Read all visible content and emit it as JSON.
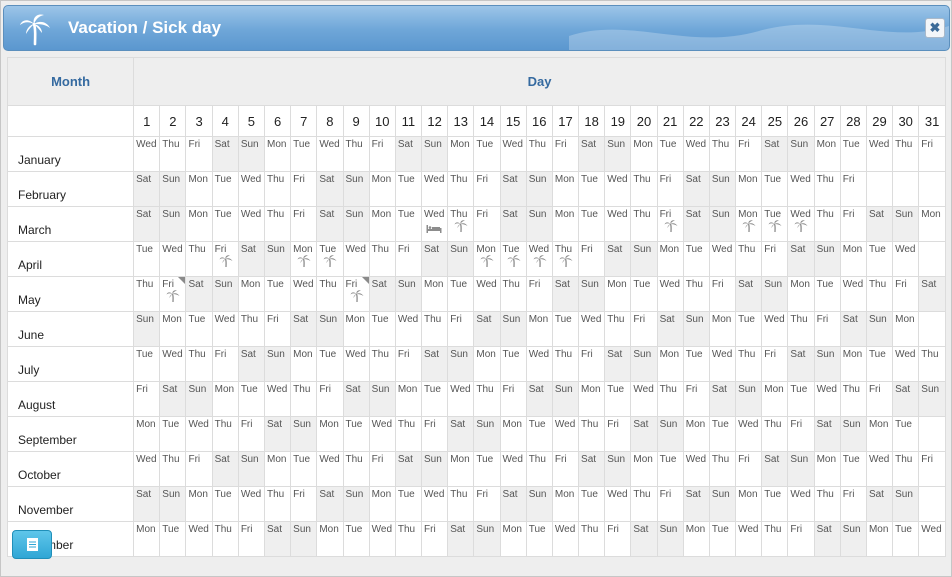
{
  "dialog": {
    "title": "Vacation / Sick day",
    "title_icon": "palm-tree-icon",
    "close_label": "✖",
    "close_icon": "close-icon"
  },
  "calendar": {
    "month_header": "Month",
    "day_header": "Day",
    "day_numbers": [
      "1",
      "2",
      "3",
      "4",
      "5",
      "6",
      "7",
      "8",
      "9",
      "10",
      "11",
      "12",
      "13",
      "14",
      "15",
      "16",
      "17",
      "18",
      "19",
      "20",
      "21",
      "22",
      "23",
      "24",
      "25",
      "26",
      "27",
      "28",
      "29",
      "30",
      "31"
    ],
    "weekday_colors": {
      "weekend_bg": "#efefef",
      "weekday_bg": "#ffffff",
      "header_blue": "#356aa0"
    },
    "months": [
      {
        "name": "January",
        "weekdays": [
          "Wed",
          "Thu",
          "Fri",
          "Sat",
          "Sun",
          "Mon",
          "Tue",
          "Wed",
          "Thu",
          "Fri",
          "Sat",
          "Sun",
          "Mon",
          "Tue",
          "Wed",
          "Thu",
          "Fri",
          "Sat",
          "Sun",
          "Mon",
          "Tue",
          "Wed",
          "Thu",
          "Fri",
          "Sat",
          "Sun",
          "Mon",
          "Tue",
          "Wed",
          "Thu",
          "Fri"
        ],
        "marks": {}
      },
      {
        "name": "February",
        "weekdays": [
          "Sat",
          "Sun",
          "Mon",
          "Tue",
          "Wed",
          "Thu",
          "Fri",
          "Sat",
          "Sun",
          "Mon",
          "Tue",
          "Wed",
          "Thu",
          "Fri",
          "Sat",
          "Sun",
          "Mon",
          "Tue",
          "Wed",
          "Thu",
          "Fri",
          "Sat",
          "Sun",
          "Mon",
          "Tue",
          "Wed",
          "Thu",
          "Fri"
        ],
        "marks": {}
      },
      {
        "name": "March",
        "weekdays": [
          "Sat",
          "Sun",
          "Mon",
          "Tue",
          "Wed",
          "Thu",
          "Fri",
          "Sat",
          "Sun",
          "Mon",
          "Tue",
          "Wed",
          "Thu",
          "Fri",
          "Sat",
          "Sun",
          "Mon",
          "Tue",
          "Wed",
          "Thu",
          "Fri",
          "Sat",
          "Sun",
          "Mon",
          "Tue",
          "Wed",
          "Thu",
          "Fri",
          "Sat",
          "Sun",
          "Mon"
        ],
        "marks": {
          "12": "sick",
          "13": "vacation",
          "21": "vacation",
          "24": "vacation",
          "25": "vacation",
          "26": "vacation"
        }
      },
      {
        "name": "April",
        "weekdays": [
          "Tue",
          "Wed",
          "Thu",
          "Fri",
          "Sat",
          "Sun",
          "Mon",
          "Tue",
          "Wed",
          "Thu",
          "Fri",
          "Sat",
          "Sun",
          "Mon",
          "Tue",
          "Wed",
          "Thu",
          "Fri",
          "Sat",
          "Sun",
          "Mon",
          "Tue",
          "Wed",
          "Thu",
          "Fri",
          "Sat",
          "Sun",
          "Mon",
          "Tue",
          "Wed"
        ],
        "marks": {
          "4": "vacation",
          "7": "vacation",
          "8": "vacation",
          "14": "vacation",
          "15": "vacation",
          "16": "vacation",
          "17": "vacation"
        }
      },
      {
        "name": "May",
        "weekdays": [
          "Thu",
          "Fri",
          "Sat",
          "Sun",
          "Mon",
          "Tue",
          "Wed",
          "Thu",
          "Fri",
          "Sat",
          "Sun",
          "Mon",
          "Tue",
          "Wed",
          "Thu",
          "Fri",
          "Sat",
          "Sun",
          "Mon",
          "Tue",
          "Wed",
          "Thu",
          "Fri",
          "Sat",
          "Sun",
          "Mon",
          "Tue",
          "Wed",
          "Thu",
          "Fri",
          "Sat"
        ],
        "marks": {
          "2": "vacation-flag",
          "9": "vacation-flag"
        }
      },
      {
        "name": "June",
        "weekdays": [
          "Sun",
          "Mon",
          "Tue",
          "Wed",
          "Thu",
          "Fri",
          "Sat",
          "Sun",
          "Mon",
          "Tue",
          "Wed",
          "Thu",
          "Fri",
          "Sat",
          "Sun",
          "Mon",
          "Tue",
          "Wed",
          "Thu",
          "Fri",
          "Sat",
          "Sun",
          "Mon",
          "Tue",
          "Wed",
          "Thu",
          "Fri",
          "Sat",
          "Sun",
          "Mon"
        ],
        "marks": {}
      },
      {
        "name": "July",
        "weekdays": [
          "Tue",
          "Wed",
          "Thu",
          "Fri",
          "Sat",
          "Sun",
          "Mon",
          "Tue",
          "Wed",
          "Thu",
          "Fri",
          "Sat",
          "Sun",
          "Mon",
          "Tue",
          "Wed",
          "Thu",
          "Fri",
          "Sat",
          "Sun",
          "Mon",
          "Tue",
          "Wed",
          "Thu",
          "Fri",
          "Sat",
          "Sun",
          "Mon",
          "Tue",
          "Wed",
          "Thu"
        ],
        "marks": {}
      },
      {
        "name": "August",
        "weekdays": [
          "Fri",
          "Sat",
          "Sun",
          "Mon",
          "Tue",
          "Wed",
          "Thu",
          "Fri",
          "Sat",
          "Sun",
          "Mon",
          "Tue",
          "Wed",
          "Thu",
          "Fri",
          "Sat",
          "Sun",
          "Mon",
          "Tue",
          "Wed",
          "Thu",
          "Fri",
          "Sat",
          "Sun",
          "Mon",
          "Tue",
          "Wed",
          "Thu",
          "Fri",
          "Sat",
          "Sun"
        ],
        "marks": {}
      },
      {
        "name": "September",
        "weekdays": [
          "Mon",
          "Tue",
          "Wed",
          "Thu",
          "Fri",
          "Sat",
          "Sun",
          "Mon",
          "Tue",
          "Wed",
          "Thu",
          "Fri",
          "Sat",
          "Sun",
          "Mon",
          "Tue",
          "Wed",
          "Thu",
          "Fri",
          "Sat",
          "Sun",
          "Mon",
          "Tue",
          "Wed",
          "Thu",
          "Fri",
          "Sat",
          "Sun",
          "Mon",
          "Tue"
        ],
        "marks": {}
      },
      {
        "name": "October",
        "weekdays": [
          "Wed",
          "Thu",
          "Fri",
          "Sat",
          "Sun",
          "Mon",
          "Tue",
          "Wed",
          "Thu",
          "Fri",
          "Sat",
          "Sun",
          "Mon",
          "Tue",
          "Wed",
          "Thu",
          "Fri",
          "Sat",
          "Sun",
          "Mon",
          "Tue",
          "Wed",
          "Thu",
          "Fri",
          "Sat",
          "Sun",
          "Mon",
          "Tue",
          "Wed",
          "Thu",
          "Fri"
        ],
        "marks": {}
      },
      {
        "name": "November",
        "weekdays": [
          "Sat",
          "Sun",
          "Mon",
          "Tue",
          "Wed",
          "Thu",
          "Fri",
          "Sat",
          "Sun",
          "Mon",
          "Tue",
          "Wed",
          "Thu",
          "Fri",
          "Sat",
          "Sun",
          "Mon",
          "Tue",
          "Wed",
          "Thu",
          "Fri",
          "Sat",
          "Sun",
          "Mon",
          "Tue",
          "Wed",
          "Thu",
          "Fri",
          "Sat",
          "Sun"
        ],
        "marks": {}
      },
      {
        "name": "December",
        "weekdays": [
          "Mon",
          "Tue",
          "Wed",
          "Thu",
          "Fri",
          "Sat",
          "Sun",
          "Mon",
          "Tue",
          "Wed",
          "Thu",
          "Fri",
          "Sat",
          "Sun",
          "Mon",
          "Tue",
          "Wed",
          "Thu",
          "Fri",
          "Sat",
          "Sun",
          "Mon",
          "Tue",
          "Wed",
          "Thu",
          "Fri",
          "Sat",
          "Sun",
          "Mon",
          "Tue",
          "Wed"
        ],
        "marks": {}
      }
    ]
  },
  "footer": {
    "report_button_icon": "document-icon"
  }
}
